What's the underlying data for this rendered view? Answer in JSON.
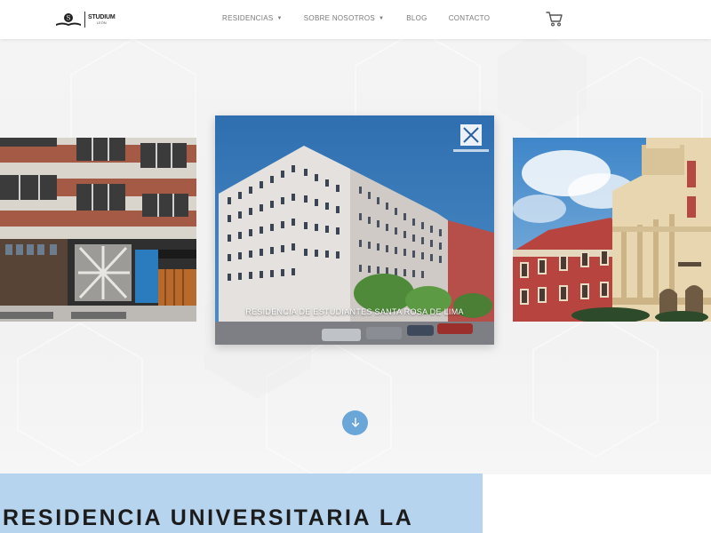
{
  "header": {
    "logo": {
      "name": "STUDIUM",
      "sub": "LEÓN"
    },
    "nav": [
      {
        "label": "RESIDENCIAS",
        "has_dropdown": true
      },
      {
        "label": "SOBRE NOSOTROS",
        "has_dropdown": true
      },
      {
        "label": "BLOG",
        "has_dropdown": false
      },
      {
        "label": "CONTACTO",
        "has_dropdown": false
      }
    ],
    "cart_icon": "shopping-cart-icon"
  },
  "carousel": {
    "slides": [
      {
        "position": "left",
        "caption": ""
      },
      {
        "position": "center",
        "caption": "RESIDENCIA DE ESTUDIANTES SANTA ROSA DE LIMA"
      },
      {
        "position": "right",
        "caption": ""
      }
    ],
    "scroll_down_icon": "arrow-down-icon"
  },
  "section": {
    "title": "RESIDENCIA UNIVERSITARIA LA"
  },
  "colors": {
    "accent_blue": "#6aa6d8",
    "panel_blue": "#b7d4ee",
    "nav_text": "#7a7a7a"
  }
}
